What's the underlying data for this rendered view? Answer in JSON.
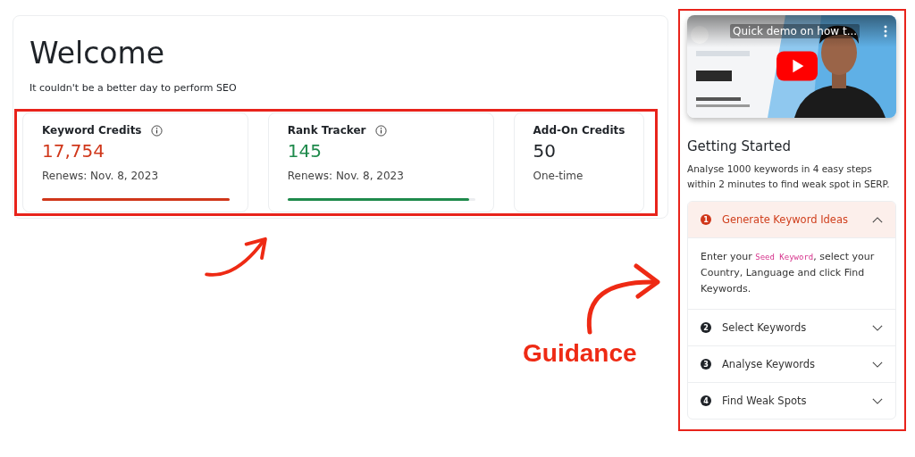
{
  "welcome": {
    "title": "Welcome",
    "subtitle": "It couldn't be a better day to perform SEO"
  },
  "stats": [
    {
      "label": "Keyword Credits",
      "info": true,
      "value": "17,754",
      "color": "#d0371a",
      "note": "Renews: Nov. 8, 2023",
      "level": 1.0
    },
    {
      "label": "Rank Tracker",
      "info": true,
      "value": "145",
      "color": "#1f8a4c",
      "note": "Renews: Nov. 8, 2023",
      "level": 0.97
    },
    {
      "label": "Add-On Credits",
      "info": false,
      "value": "50",
      "color": "#1f2328",
      "note": "One-time"
    }
  ],
  "video": {
    "title": "Quick demo on how t..."
  },
  "getting_started": {
    "title": "Getting Started",
    "description": "Analyse 1000 keywords in 4 easy steps within 2 minutes to find weak spot in SERP.",
    "steps": [
      {
        "number": "1",
        "title": "Generate Keyword Ideas",
        "expanded": true,
        "body": {
          "before": "Enter your ",
          "code": "Seed Keyword",
          "after": ", select your Country, Language and click Find Keywords."
        }
      },
      {
        "number": "2",
        "title": "Select Keywords",
        "expanded": false
      },
      {
        "number": "3",
        "title": "Analyse Keywords",
        "expanded": false
      },
      {
        "number": "4",
        "title": "Find Weak Spots",
        "expanded": false
      }
    ]
  },
  "annotation": {
    "label": "Guidance"
  }
}
